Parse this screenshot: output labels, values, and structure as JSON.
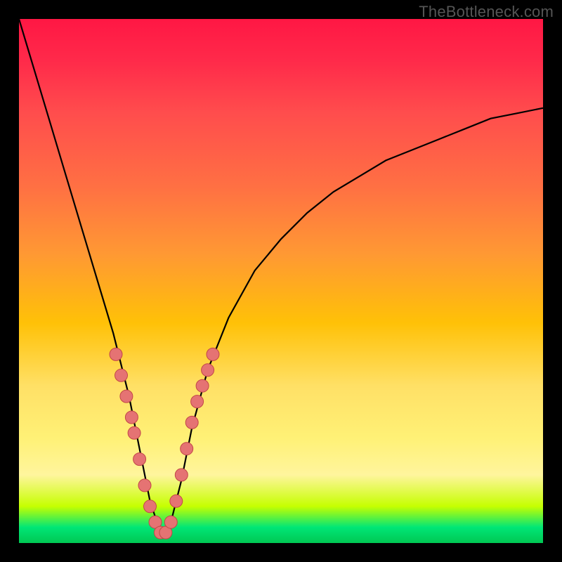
{
  "watermark": "TheBottleneck.com",
  "colors": {
    "frame": "#000000",
    "curve": "#000000",
    "marker_fill": "#e57373",
    "marker_stroke": "#c14747"
  },
  "chart_data": {
    "type": "line",
    "title": "",
    "xlabel": "",
    "ylabel": "",
    "xlim": [
      0,
      100
    ],
    "ylim": [
      0,
      100
    ],
    "description": "V-shaped bottleneck curve. Y-axis represents bottleneck severity (0 at bottom = no bottleneck / green zone, 100 at top = severe bottleneck / red zone). Curve reaches minimum near x≈27.",
    "x": [
      0,
      3,
      6,
      9,
      12,
      15,
      18,
      21,
      23,
      25,
      27,
      29,
      31,
      33,
      36,
      40,
      45,
      50,
      55,
      60,
      65,
      70,
      75,
      80,
      85,
      90,
      95,
      100
    ],
    "values": [
      100,
      90,
      80,
      70,
      60,
      50,
      40,
      28,
      18,
      8,
      2,
      4,
      12,
      22,
      33,
      43,
      52,
      58,
      63,
      67,
      70,
      73,
      75,
      77,
      79,
      81,
      82,
      83
    ],
    "markers": {
      "x": [
        18.5,
        19.5,
        20.5,
        21.5,
        22.0,
        23.0,
        24.0,
        25.0,
        26.0,
        27.0,
        28.0,
        29.0,
        30.0,
        31.0,
        32.0,
        33.0,
        34.0,
        35.0,
        36.0,
        37.0
      ],
      "y": [
        36,
        32,
        28,
        24,
        21,
        16,
        11,
        7,
        4,
        2,
        2,
        4,
        8,
        13,
        18,
        23,
        27,
        30,
        33,
        36
      ]
    }
  }
}
